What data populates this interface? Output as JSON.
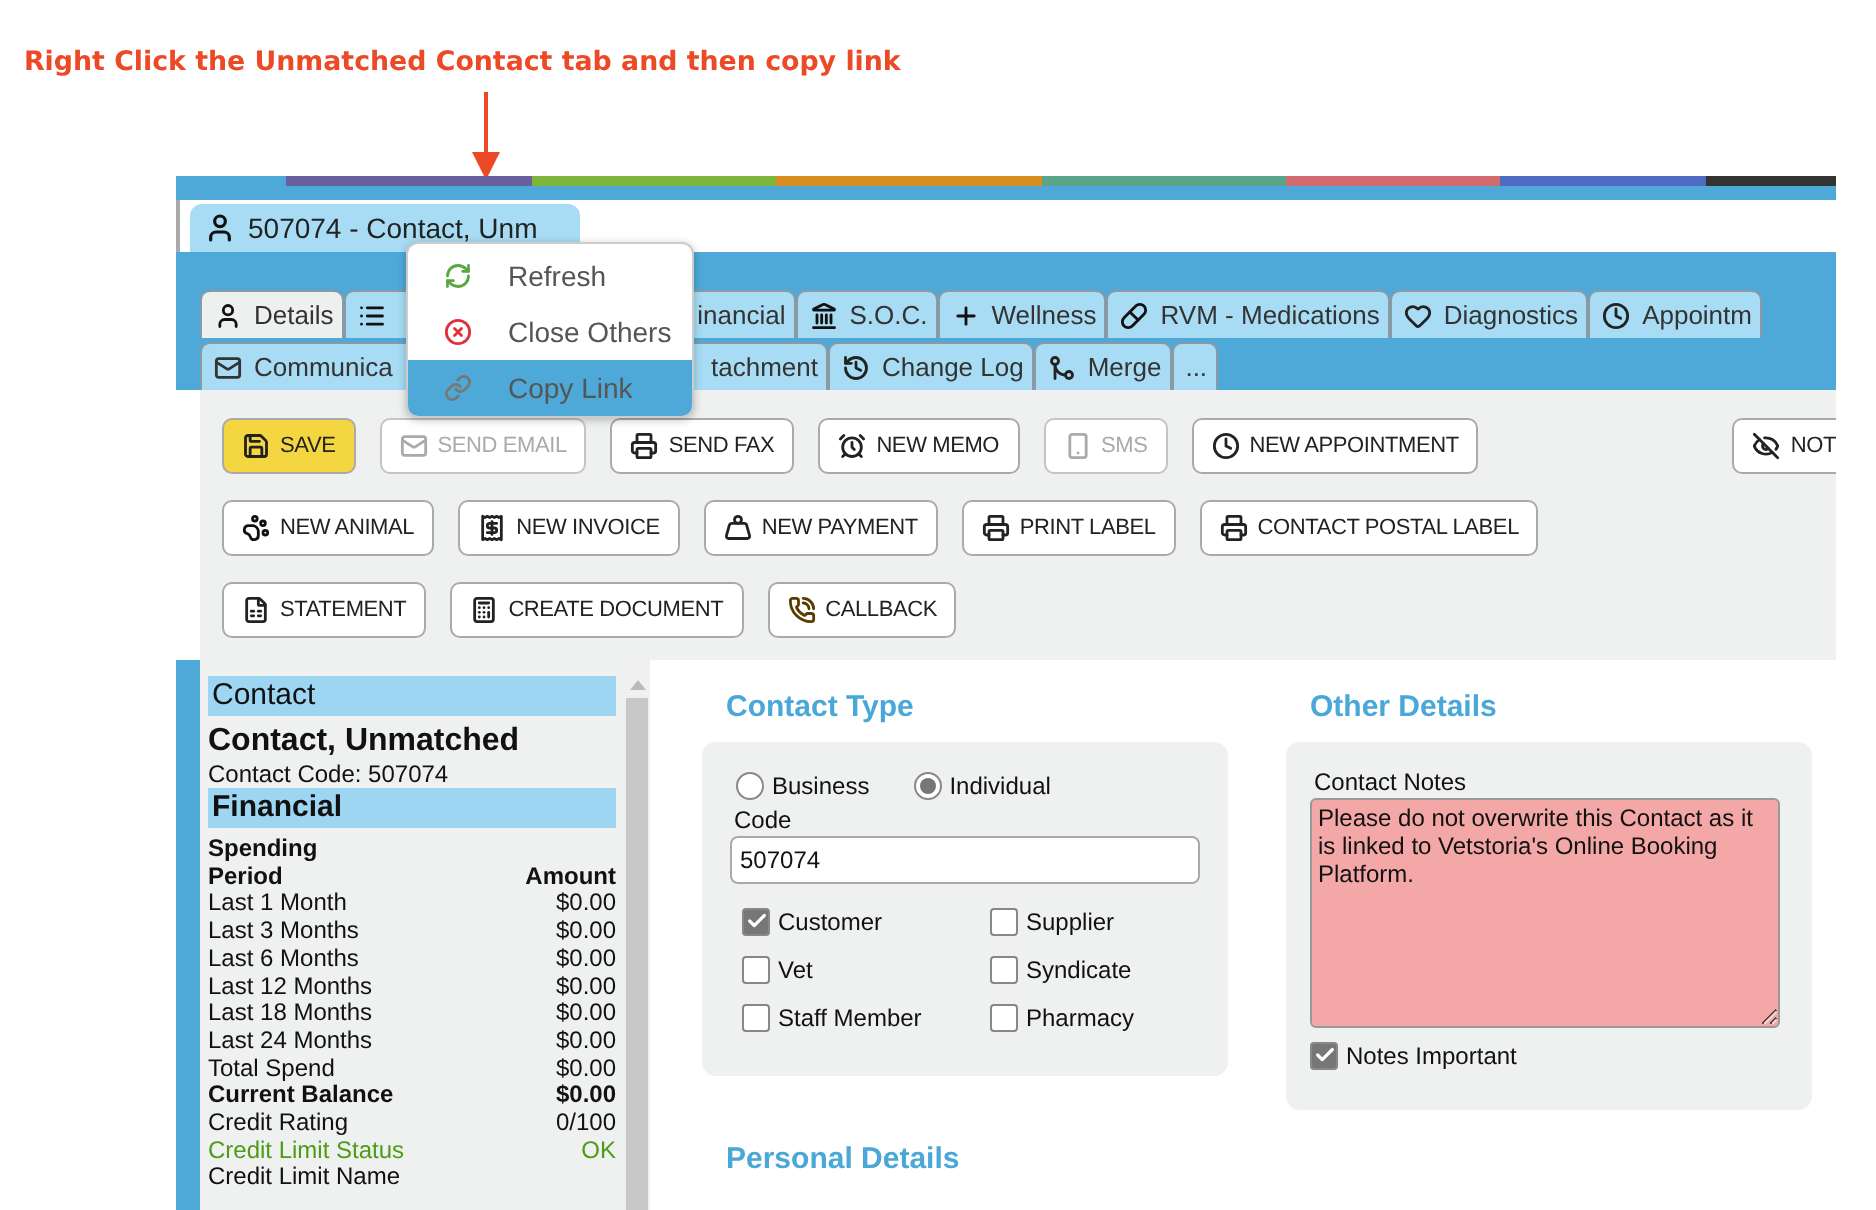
{
  "annotation": {
    "text": "Right Click the Unmatched Contact tab and then copy link"
  },
  "document_tab": {
    "label": "507074 - Contact, Unm"
  },
  "context_menu": {
    "items": [
      {
        "label": "Refresh",
        "kind": "refresh",
        "selected": false
      },
      {
        "label": "Close Others",
        "kind": "close",
        "selected": false
      },
      {
        "label": "Copy Link",
        "kind": "link",
        "selected": true
      }
    ]
  },
  "tabs_row_1": [
    {
      "label": "Details",
      "kind": "person",
      "selected": true
    },
    {
      "kind": "list",
      "selected": false
    },
    {
      "label": "inancial",
      "kind": "none",
      "selected": false
    },
    {
      "label": "S.O.C.",
      "kind": "bank",
      "selected": false
    },
    {
      "label": "Wellness",
      "kind": "plus",
      "selected": false
    },
    {
      "label": "RVM - Medications",
      "kind": "pill",
      "selected": false
    },
    {
      "label": "Diagnostics",
      "kind": "heart",
      "selected": false
    },
    {
      "label": "Appointm",
      "kind": "clock",
      "selected": false
    }
  ],
  "tabs_row_2": [
    {
      "label": "Communica",
      "kind": "mail",
      "selected": false
    },
    {
      "label": "tachment",
      "kind": "none",
      "selected": false
    },
    {
      "label": "Change Log",
      "kind": "history",
      "selected": false
    },
    {
      "label": "Merge",
      "kind": "merge",
      "selected": false
    },
    {
      "label": "...",
      "kind": "none",
      "selected": false
    }
  ],
  "toolbar": {
    "rows": [
      {
        "buttons": [
          {
            "label": "SAVE",
            "kind": "save",
            "highlighted": true,
            "disabled": false
          },
          {
            "label": "SEND EMAIL",
            "kind": "mail",
            "highlighted": false,
            "disabled": true
          },
          {
            "label": "SEND FAX",
            "kind": "printer",
            "highlighted": false,
            "disabled": false
          },
          {
            "label": "NEW MEMO",
            "kind": "alarm",
            "highlighted": false,
            "disabled": false
          },
          {
            "label": "SMS",
            "kind": "phone",
            "highlighted": false,
            "disabled": true
          },
          {
            "label": "NEW APPOINTMENT",
            "kind": "clock",
            "highlighted": false,
            "disabled": false
          },
          {
            "label": "NOT",
            "kind": "eye-off",
            "highlighted": false,
            "disabled": false,
            "pinned_right": true
          }
        ]
      },
      {
        "buttons": [
          {
            "label": "NEW ANIMAL",
            "kind": "paw",
            "highlighted": false,
            "disabled": false
          },
          {
            "label": "NEW INVOICE",
            "kind": "invoice",
            "highlighted": false,
            "disabled": false
          },
          {
            "label": "NEW PAYMENT",
            "kind": "weight",
            "highlighted": false,
            "disabled": false
          },
          {
            "label": "PRINT LABEL",
            "kind": "printer",
            "highlighted": false,
            "disabled": false
          },
          {
            "label": "CONTACT POSTAL LABEL",
            "kind": "printer",
            "highlighted": false,
            "disabled": false
          }
        ]
      },
      {
        "buttons": [
          {
            "label": "STATEMENT",
            "kind": "statement",
            "highlighted": false,
            "disabled": false
          },
          {
            "label": "CREATE DOCUMENT",
            "kind": "calculator",
            "highlighted": false,
            "disabled": false
          },
          {
            "label": "CALLBACK",
            "kind": "callback",
            "highlighted": false,
            "disabled": false
          }
        ]
      }
    ]
  },
  "sidebar": {
    "contact": {
      "header": "Contact",
      "name": "Contact, Unmatched",
      "code": "Contact Code: 507074"
    },
    "financial": {
      "header": "Financial",
      "subheading": "Spending",
      "columns": [
        "Period",
        "Amount"
      ],
      "rows": [
        {
          "label": "Last 1 Month",
          "value": "$0.00",
          "kind": "normal"
        },
        {
          "label": "Last 3 Months",
          "value": "$0.00",
          "kind": "normal"
        },
        {
          "label": "Last 6 Months",
          "value": "$0.00",
          "kind": "normal"
        },
        {
          "label": "Last 12 Months",
          "value": "$0.00",
          "kind": "normal"
        },
        {
          "label": "Last 18 Months",
          "value": "$0.00",
          "kind": "normal"
        },
        {
          "label": "Last 24 Months",
          "value": "$0.00",
          "kind": "normal"
        },
        {
          "label": "Total Spend",
          "value": "$0.00",
          "kind": "normal"
        },
        {
          "label": "Current Balance",
          "value": "$0.00",
          "kind": "bold"
        },
        {
          "label": "Credit Rating",
          "value": "0/100",
          "kind": "normal"
        },
        {
          "label": "Credit Limit Status",
          "value": "OK",
          "kind": "status"
        },
        {
          "label": "Credit Limit Name",
          "kind": "normal"
        }
      ]
    }
  },
  "contact_type": {
    "heading": "Contact Type",
    "radios": [
      {
        "label": "Business",
        "selected": false
      },
      {
        "label": "Individual",
        "selected": true
      }
    ],
    "code": {
      "label": "Code",
      "value": "507074"
    },
    "checkboxes": [
      {
        "label": "Customer",
        "checked": true
      },
      {
        "label": "Supplier",
        "checked": false
      },
      {
        "label": "Vet",
        "checked": false
      },
      {
        "label": "Syndicate",
        "checked": false
      },
      {
        "label": "Staff Member",
        "checked": false
      },
      {
        "label": "Pharmacy",
        "checked": false
      }
    ]
  },
  "other_details": {
    "heading": "Other Details",
    "notes": {
      "label": "Contact Notes",
      "value": "Please do not overwrite this Contact as it is linked to Vetstoria's Online Booking Platform."
    },
    "notes_important": {
      "label": "Notes Important",
      "checked": true
    }
  },
  "personal_details": {
    "heading": "Personal Details"
  }
}
